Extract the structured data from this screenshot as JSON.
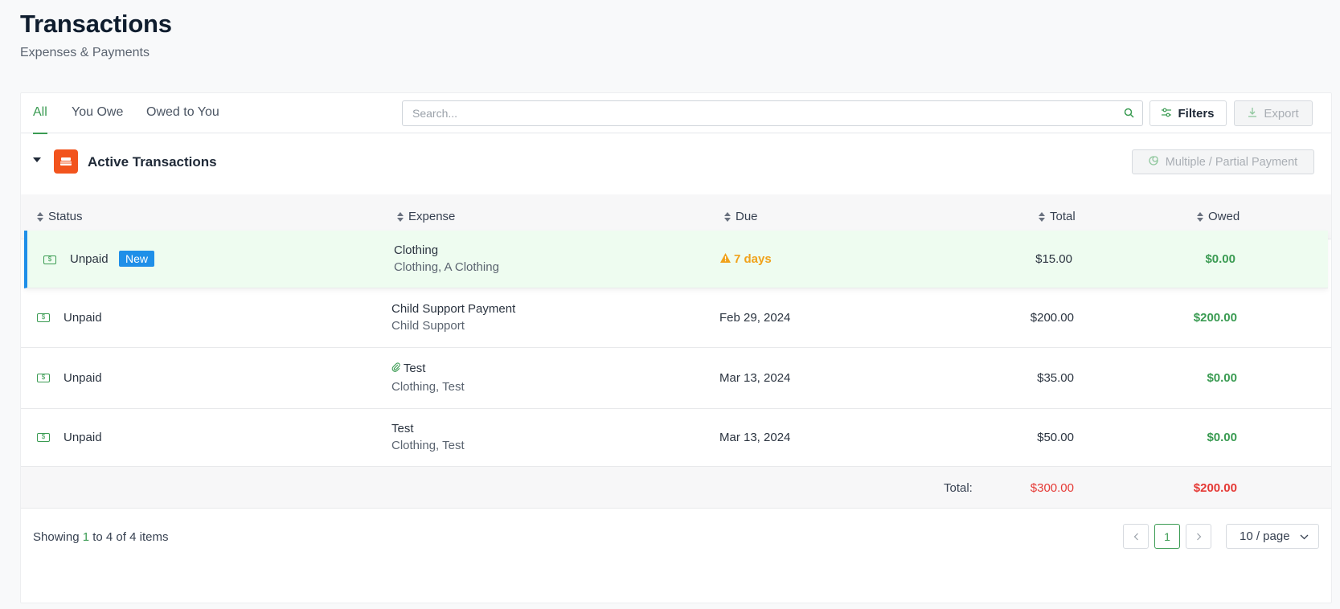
{
  "page": {
    "title": "Transactions",
    "subtitle": "Expenses & Payments"
  },
  "tabs": [
    {
      "label": "All",
      "active": true
    },
    {
      "label": "You Owe",
      "active": false
    },
    {
      "label": "Owed to You",
      "active": false
    }
  ],
  "search": {
    "placeholder": "Search...",
    "value": ""
  },
  "toolbar": {
    "filters_label": "Filters",
    "export_label": "Export"
  },
  "section": {
    "title": "Active Transactions",
    "multi_payment_label": "Multiple / Partial Payment"
  },
  "table": {
    "columns": {
      "status": "Status",
      "expense": "Expense",
      "due": "Due",
      "total": "Total",
      "owed": "Owed"
    },
    "rows": [
      {
        "status": "Unpaid",
        "badge": "New",
        "expense_title": "Clothing",
        "expense_sub": "Clothing, A Clothing",
        "due": "7 days",
        "total": "$15.00",
        "owed": "$0.00"
      },
      {
        "status": "Unpaid",
        "expense_title": "Child Support Payment",
        "expense_sub": "Child Support",
        "due": "Feb 29, 2024",
        "total": "$200.00",
        "owed": "$200.00"
      },
      {
        "status": "Unpaid",
        "expense_title": "Test",
        "expense_sub": "Clothing, Test",
        "due": "Mar 13, 2024",
        "total": "$35.00",
        "owed": "$0.00"
      },
      {
        "status": "Unpaid",
        "expense_title": "Test",
        "expense_sub": "Clothing, Test",
        "due": "Mar 13, 2024",
        "total": "$50.00",
        "owed": "$0.00"
      }
    ],
    "totals": {
      "label": "Total:",
      "total": "$300.00",
      "owed": "$200.00"
    }
  },
  "pagination": {
    "showing_prefix": "Showing",
    "from": "1",
    "to_text": "to 4 of 4 items",
    "current_page": "1",
    "page_size": "10 / page"
  },
  "colors": {
    "accent": "#3a9b52",
    "new_badge": "#1f8fe8",
    "warning": "#f0a21b",
    "danger": "#e53935",
    "section_icon": "#f2541e"
  }
}
